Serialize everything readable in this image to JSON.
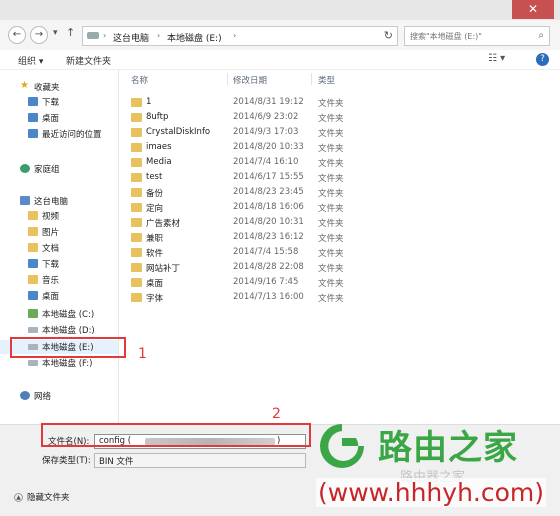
{
  "window": {
    "close_glyph": "✕"
  },
  "nav_buttons": {
    "back_glyph": "←",
    "forward_glyph": "→",
    "dropdown_glyph": "▾",
    "up_glyph": "↑"
  },
  "address": {
    "crumbs": [
      "这台电脑",
      "本地磁盘 (E:)"
    ],
    "separator": "›",
    "refresh_glyph": "↻"
  },
  "search": {
    "placeholder": "搜索\"本地磁盘 (E:)\"",
    "icon": "search-icon"
  },
  "toolbar": {
    "organize": "组织 ▾",
    "new_folder": "新建文件夹",
    "view_glyph": "☷ ▾",
    "help_glyph": "?"
  },
  "navpane": {
    "favorites": "收藏夹",
    "downloads": "下载",
    "desktop": "桌面",
    "recent": "最近访问的位置",
    "homegroup": "家庭组",
    "this_pc": "这台电脑",
    "videos": "视频",
    "pictures": "图片",
    "documents": "文档",
    "downloads2": "下载",
    "music": "音乐",
    "desktop2": "桌面",
    "drive_c": "本地磁盘 (C:)",
    "drive_d": "本地磁盘 (D:)",
    "drive_e": "本地磁盘 (E:)",
    "drive_f": "本地磁盘 (F:)",
    "network": "网络"
  },
  "columns": {
    "name": "名称",
    "date": "修改日期",
    "type": "类型"
  },
  "files": [
    {
      "name": "1",
      "date": "2014/8/31 19:12",
      "type": "文件夹"
    },
    {
      "name": "8uftp",
      "date": "2014/6/9 23:02",
      "type": "文件夹"
    },
    {
      "name": "CrystalDiskInfo",
      "date": "2014/9/3 17:03",
      "type": "文件夹"
    },
    {
      "name": "imaes",
      "date": "2014/8/20 10:33",
      "type": "文件夹"
    },
    {
      "name": "Media",
      "date": "2014/7/4 16:10",
      "type": "文件夹"
    },
    {
      "name": "test",
      "date": "2014/6/17 15:55",
      "type": "文件夹"
    },
    {
      "name": "备份",
      "date": "2014/8/23 23:45",
      "type": "文件夹"
    },
    {
      "name": "定向",
      "date": "2014/8/18 16:06",
      "type": "文件夹"
    },
    {
      "name": "广告素材",
      "date": "2014/8/20 10:31",
      "type": "文件夹"
    },
    {
      "name": "兼职",
      "date": "2014/8/23 16:12",
      "type": "文件夹"
    },
    {
      "name": "软件",
      "date": "2014/7/4 15:58",
      "type": "文件夹"
    },
    {
      "name": "网站补丁",
      "date": "2014/8/28 22:08",
      "type": "文件夹"
    },
    {
      "name": "桌面",
      "date": "2014/9/16 7:45",
      "type": "文件夹"
    },
    {
      "name": "字体",
      "date": "2014/7/13 16:00",
      "type": "文件夹"
    }
  ],
  "bottom": {
    "filename_label": "文件名(N):",
    "filename_prefix": "config (",
    "filename_suffix": ")",
    "filetype_label": "保存类型(T):",
    "filetype_value": "BIN 文件",
    "hide_folders": "隐藏文件夹",
    "hide_glyph": "▲"
  },
  "annotations": {
    "one": "1",
    "two": "2",
    "color": "#e0393e"
  },
  "watermark": {
    "title": "路由之家",
    "url": "(www.hhhyh.com)",
    "faint": "路由器之家",
    "title_color": "#3aa645",
    "url_color": "#c7252a"
  }
}
